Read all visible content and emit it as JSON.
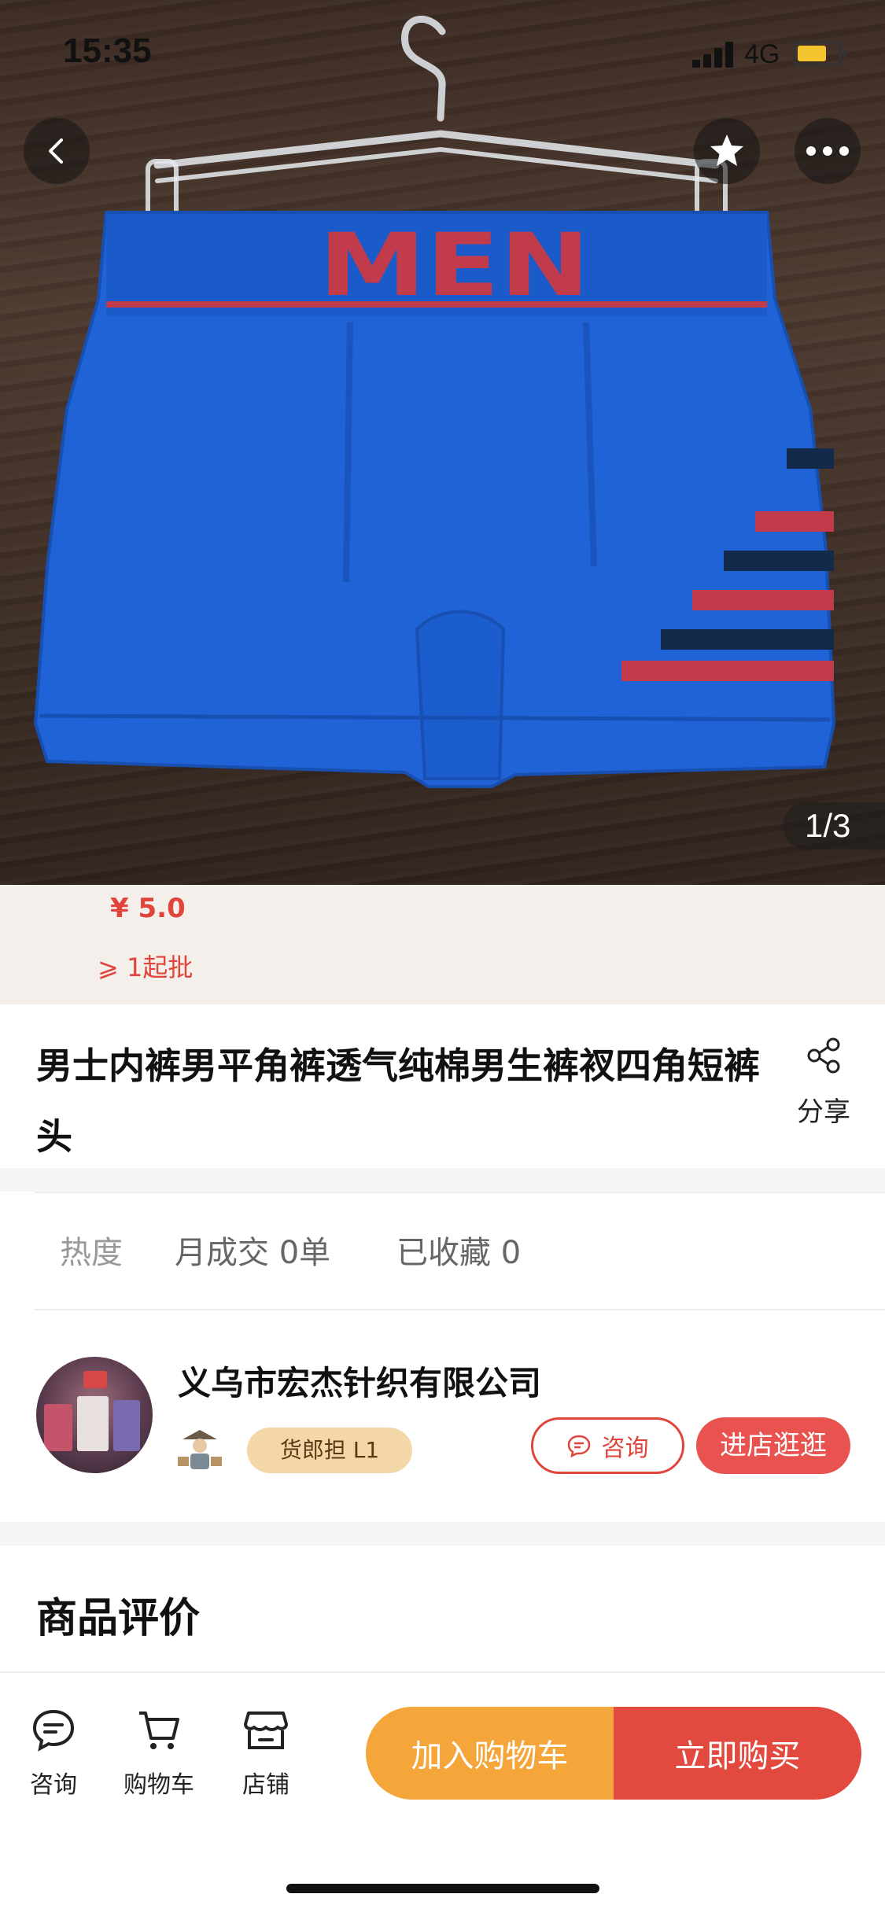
{
  "status_bar": {
    "time": "15:35",
    "network": "4G"
  },
  "hero": {
    "image_counter": "1/3",
    "product_print_text": "MEN",
    "colors": {
      "fabric": "#1f63d6",
      "accent_red": "#c23b4a",
      "accent_navy": "#142a4a"
    }
  },
  "nav": {
    "back_icon": "back-chevron-icon",
    "favorite_icon": "star-icon",
    "more_icon": "more-dots-icon"
  },
  "pricing": {
    "price": "¥ 5.0",
    "min_order": "⩾ 1起批"
  },
  "product": {
    "title": "男士内裤男平角裤透气纯棉男生裤衩四角短裤头",
    "share_label": "分享"
  },
  "stats": {
    "heat_label": "热度",
    "monthly_sales": "月成交 0单",
    "favorites": "已收藏 0"
  },
  "shop": {
    "name": "义乌市宏杰针织有限公司",
    "badge": "货郎担 L1",
    "consult_label": "咨询",
    "visit_store_label": "进店逛逛"
  },
  "reviews": {
    "title": "商品评价"
  },
  "bottom_bar": {
    "consult_label": "咨询",
    "cart_label": "购物车",
    "shop_label": "店铺",
    "add_to_cart_label": "加入购物车",
    "buy_now_label": "立即购买"
  },
  "colors": {
    "accent": "#e0453c",
    "orange": "#f5a63a",
    "badge_bg": "#f3d7a9"
  }
}
